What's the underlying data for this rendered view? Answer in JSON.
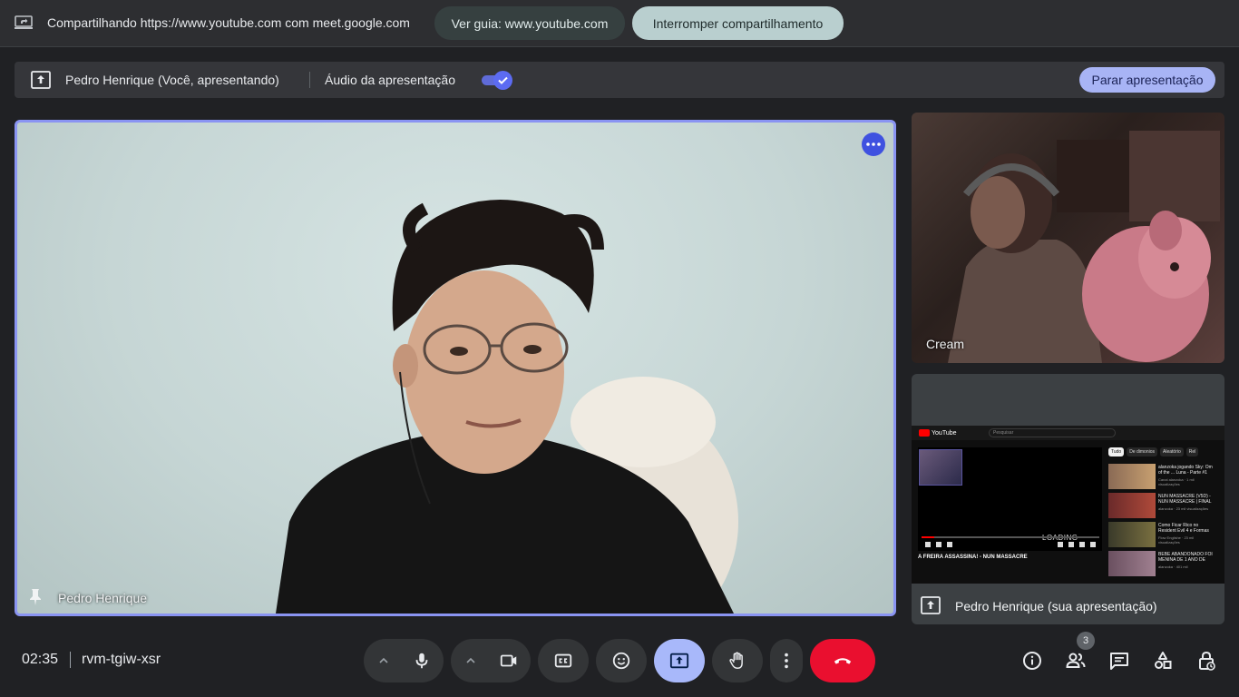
{
  "share_bar": {
    "text": "Compartilhando https://www.youtube.com com meet.google.com",
    "view_tab_label": "Ver guia: www.youtube.com",
    "stop_sharing_label": "Interromper compartilhamento"
  },
  "presentation_bar": {
    "presenter": "Pedro Henrique (Você, apresentando)",
    "audio_label": "Áudio da apresentação",
    "audio_enabled": true,
    "stop_label": "Parar apresentação"
  },
  "tiles": {
    "main": {
      "name": "Pedro Henrique"
    },
    "secondary": {
      "name": "Cream"
    },
    "screen": {
      "name": "Pedro Henrique (sua apresentação)",
      "preview": {
        "site": "YouTube",
        "search_placeholder": "Pesquisar",
        "loading_text": "LOADING",
        "video_title": "A FREIRA ASSASSINA! - NUN MASSACRE",
        "chips": [
          "Tudo",
          "De dimonios",
          "Aleatório",
          "Rel"
        ],
        "recommendations": [
          {
            "title": "alanzoka jogando Sky: Om of the ... Luna - Parte #1",
            "meta": "Canal alanzoka · 1 mil visualizações"
          },
          {
            "title": "NUN MASSACRE (V5D) - NUN MASSACRE | FINAL",
            "meta": "alanzoka · 23 mil visualizações"
          },
          {
            "title": "Como Ficar Rico no Resident Evil 4 e Formas",
            "meta": "Flow Englishe · 23 mil visualizações"
          },
          {
            "title": "BEBÊ ABANDONADO FOI MENINA DE 1 ANO DE",
            "meta": "alanzoka · 401 mil"
          }
        ]
      }
    }
  },
  "bottom_bar": {
    "time": "02:35",
    "meeting_code": "rvm-tgiw-xsr",
    "participant_count": "3"
  },
  "icons": {
    "share": "laptop-share-icon",
    "present": "present-to-all-icon",
    "more": "more-horizontal-icon",
    "pin": "pin-icon",
    "mic": "mic-icon",
    "camera": "videocam-icon",
    "captions": "closed-caption-icon",
    "reactions": "emoji-icon",
    "hand": "raise-hand-icon",
    "more_vert": "more-vertical-icon",
    "end_call": "call-end-icon",
    "info": "info-icon",
    "people": "people-icon",
    "chat": "chat-icon",
    "activities": "activities-icon",
    "host_controls": "host-controls-lock-icon"
  },
  "colors": {
    "accent": "#8a94f2",
    "end_call": "#ea0f2f",
    "active_button": "#a8b8fa"
  }
}
